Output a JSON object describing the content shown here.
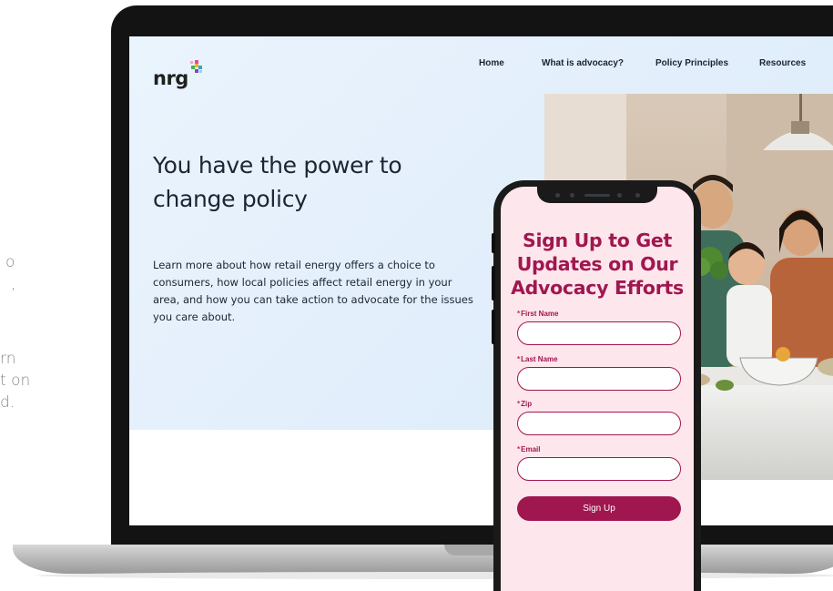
{
  "side_text": [
    "o",
    ",",
    "rn",
    "t on",
    "d."
  ],
  "nav": {
    "logo": "nrg",
    "items": [
      "Home",
      "What is advocacy?",
      "Policy Principles",
      "Resources"
    ]
  },
  "hero": {
    "title": "You have the power to change policy",
    "body": "Learn more about how retail energy offers a choice to consumers, how local policies affect retail energy in your area, and how you can take action to advocate for the issues you care about."
  },
  "signup": {
    "title": "Sign Up to Get Updates on Our Advocacy Efforts",
    "required_mark": "*",
    "fields": [
      {
        "label": "First Name",
        "value": ""
      },
      {
        "label": "Last Name",
        "value": ""
      },
      {
        "label": "Zip",
        "value": ""
      },
      {
        "label": "Email",
        "value": ""
      }
    ],
    "button": "Sign Up"
  },
  "colors": {
    "brand_magenta": "#a0174f",
    "phone_bg": "#fde6ec",
    "hero_bg": "#e2eefb",
    "text_dark": "#1d2433"
  },
  "icons": {
    "logo_mark": "multicolor-plus-icon",
    "phone_camera": "camera-icon"
  }
}
